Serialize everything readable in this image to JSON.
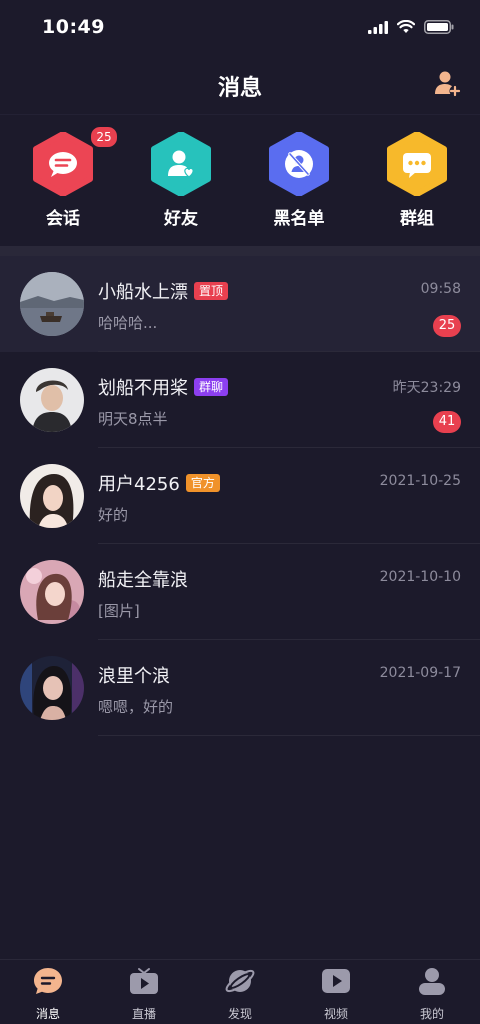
{
  "status_bar": {
    "time": "10:49"
  },
  "header": {
    "title": "消息"
  },
  "quick_actions": [
    {
      "label": "会话",
      "color": "#ec4554",
      "badge": "25"
    },
    {
      "label": "好友",
      "color": "#27c2bc"
    },
    {
      "label": "黑名单",
      "color": "#5a6df0"
    },
    {
      "label": "群组",
      "color": "#f7b92b"
    }
  ],
  "conversations": [
    {
      "name": "小船水上漂",
      "tag": "置顶",
      "tag_color": "#e8404f",
      "message": "哈哈哈...",
      "time": "09:58",
      "unread": "25"
    },
    {
      "name": "划船不用桨",
      "tag": "群聊",
      "tag_color": "#8c3ff0",
      "message": "明天8点半",
      "time": "昨天23:29",
      "unread": "41"
    },
    {
      "name": "用户4256",
      "tag": "官方",
      "tag_color": "#f0922a",
      "message": "好的",
      "time": "2021-10-25"
    },
    {
      "name": "船走全靠浪",
      "message": "[图片]",
      "time": "2021-10-10"
    },
    {
      "name": "浪里个浪",
      "message": "嗯嗯，好的",
      "time": "2021-09-17"
    }
  ],
  "tab_bar": {
    "items": [
      {
        "label": "消息",
        "active": true
      },
      {
        "label": "直播"
      },
      {
        "label": "发现"
      },
      {
        "label": "视频"
      },
      {
        "label": "我的"
      }
    ]
  }
}
